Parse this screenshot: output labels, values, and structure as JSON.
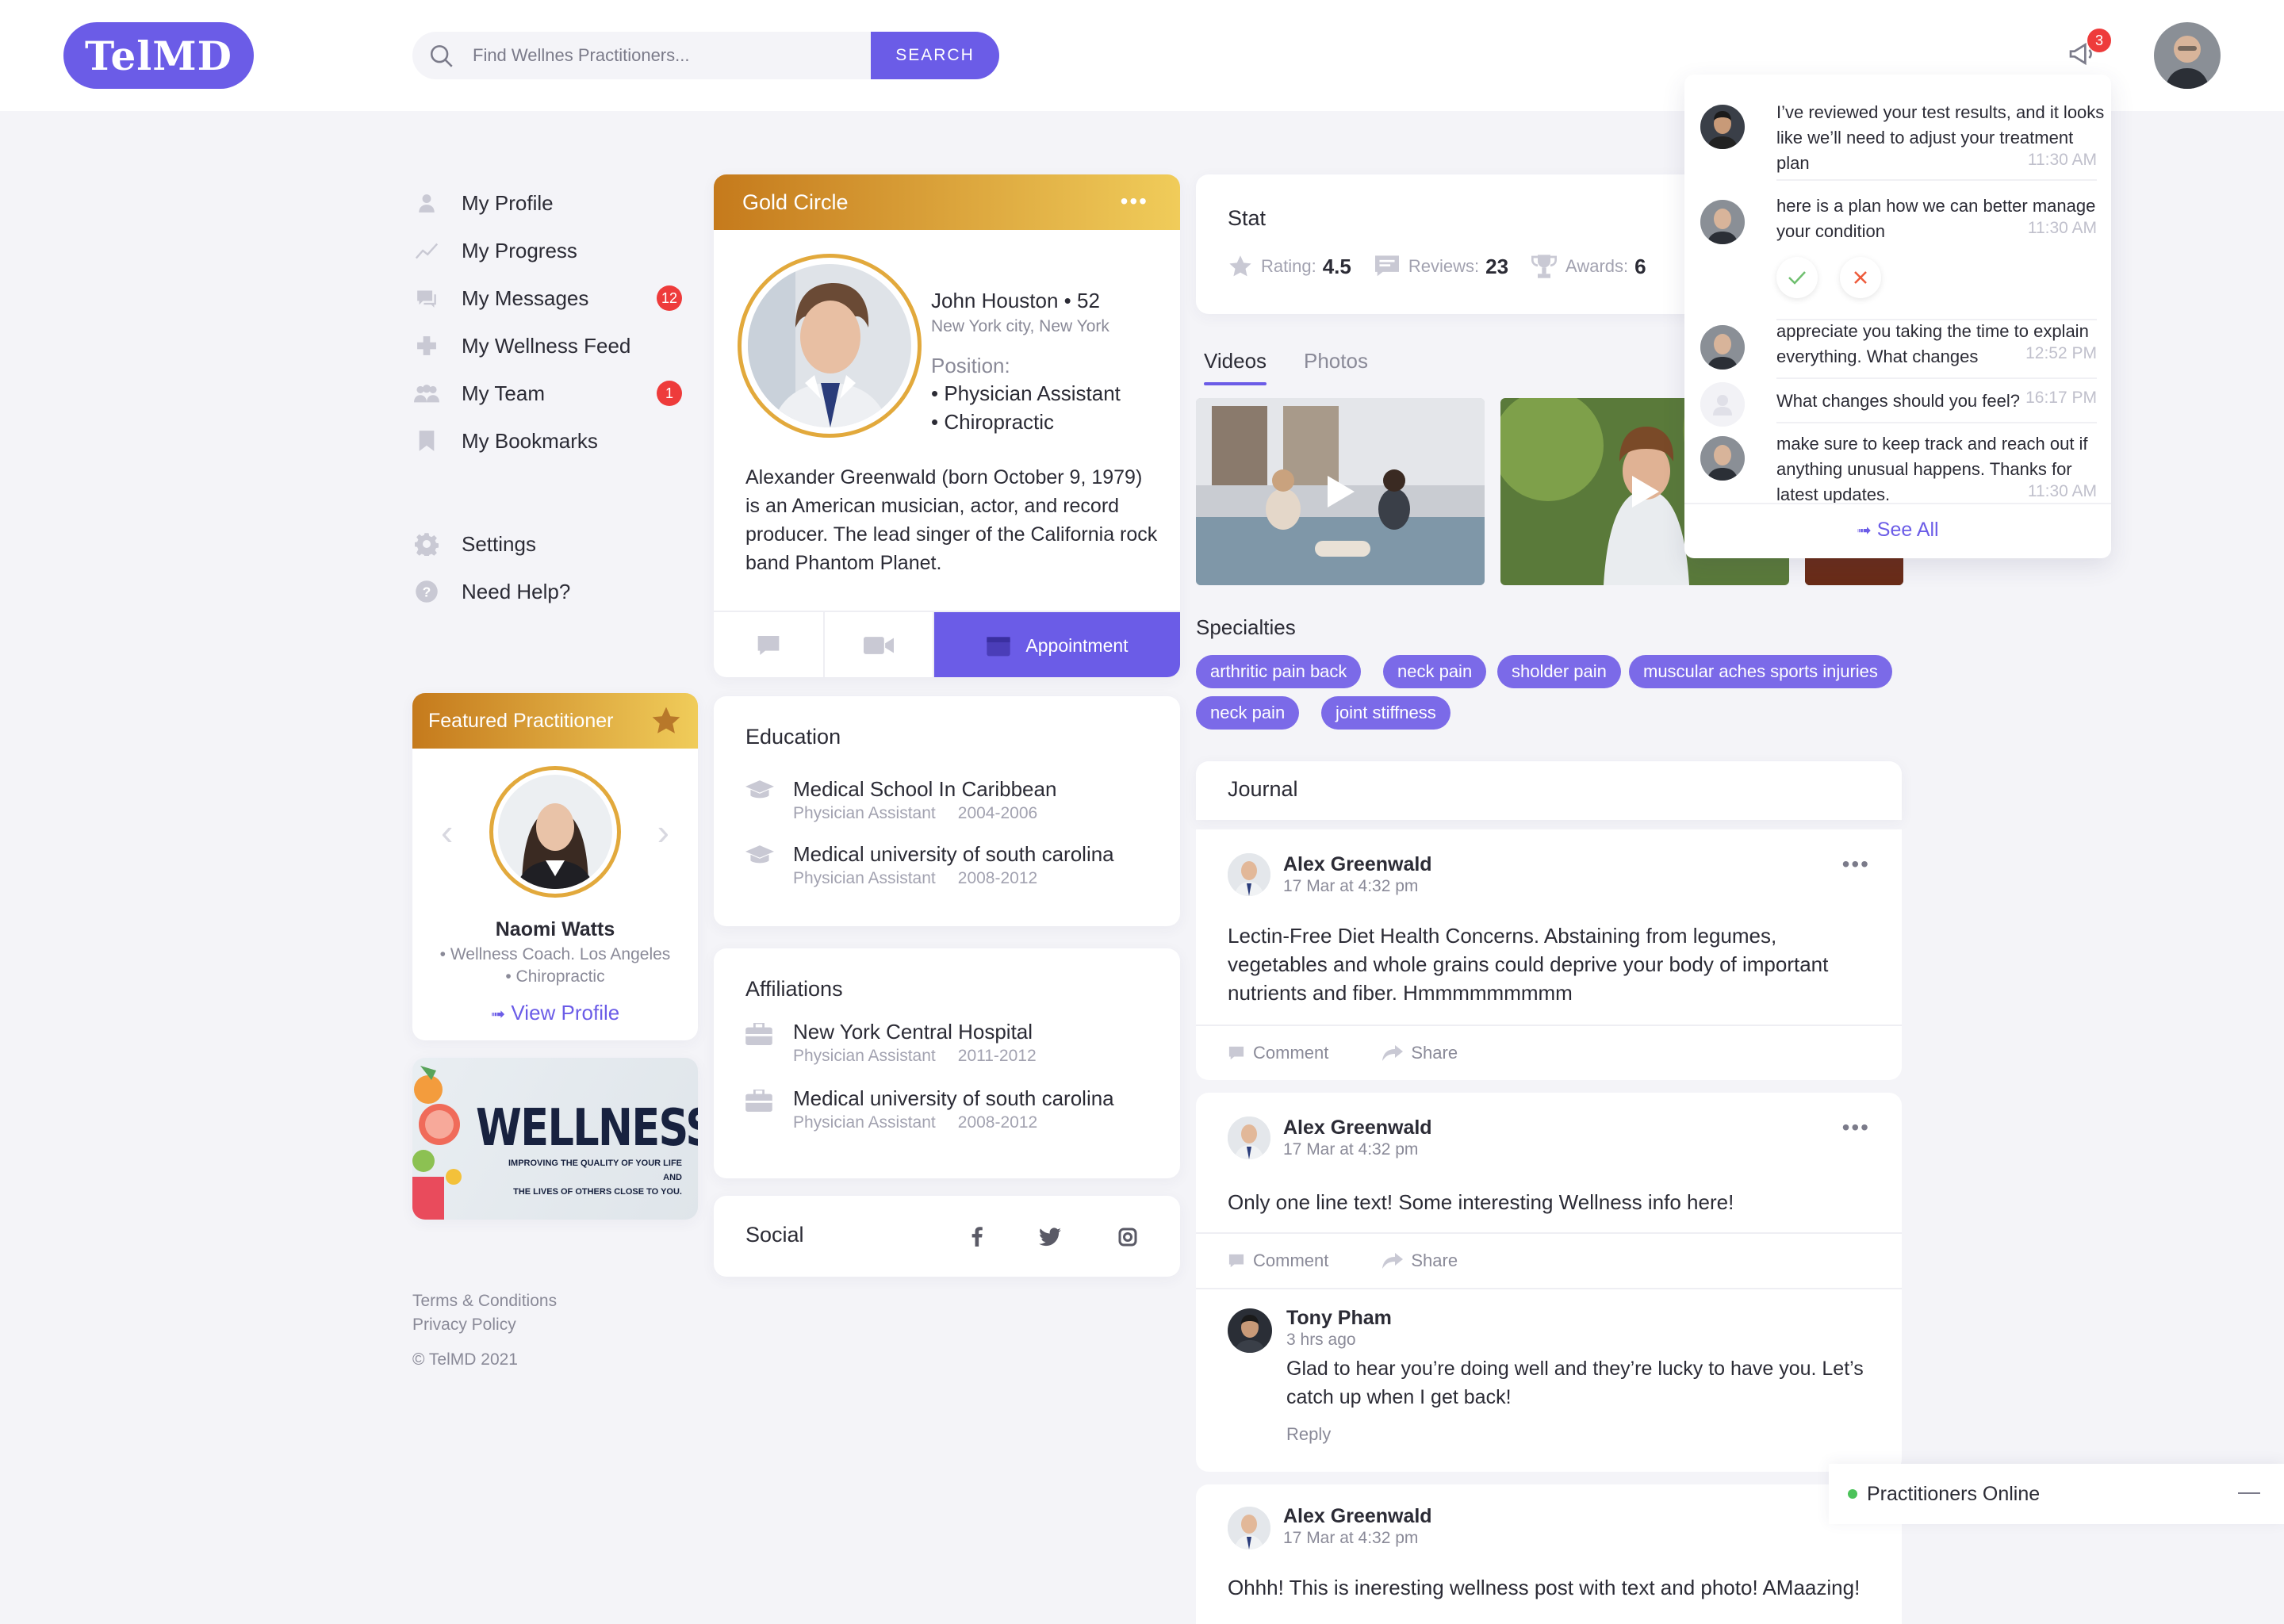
{
  "header": {
    "logo": "TelMD",
    "search_placeholder": "Find Wellnes Practitioners...",
    "search_button": "SEARCH",
    "notification_count": "3"
  },
  "nav": {
    "items": [
      {
        "label": "My Profile",
        "icon": "user-icon",
        "badge": ""
      },
      {
        "label": "My Progress",
        "icon": "progress-icon",
        "badge": ""
      },
      {
        "label": "My Messages",
        "icon": "messages-icon",
        "badge": "12"
      },
      {
        "label": "My Wellness Feed",
        "icon": "feed-icon",
        "badge": ""
      },
      {
        "label": "My Team",
        "icon": "team-icon",
        "badge": "1"
      },
      {
        "label": "My Bookmarks",
        "icon": "bookmark-icon",
        "badge": ""
      }
    ],
    "secondary": [
      {
        "label": "Settings",
        "icon": "gear-icon"
      },
      {
        "label": "Need Help?",
        "icon": "help-icon"
      }
    ]
  },
  "featured": {
    "title": "Featured Practitioner",
    "name": "Naomi Watts",
    "role1": "• Wellness Coach. Los Angeles",
    "role2": "• Chiropractic",
    "link": "View Profile"
  },
  "banner": {
    "title": "WELLNESS",
    "line1": "IMPROVING THE QUALITY OF YOUR LIFE AND",
    "line2": "THE LIVES OF OTHERS CLOSE TO YOU."
  },
  "footer": {
    "terms": "Terms & Conditions",
    "privacy": "Privacy Policy",
    "copyright": "© TelMD 2021"
  },
  "profile": {
    "tier": "Gold Circle",
    "name": "John Houston • 52",
    "location": "New York city, New York",
    "position_label": "Position:",
    "positions": [
      "• Physician Assistant",
      "• Chiropractic"
    ],
    "bio": "Alexander Greenwald (born October 9, 1979) is an American musician, actor, and record producer. The lead singer of the California rock band Phantom Planet.",
    "appointment": "Appointment"
  },
  "education": {
    "title": "Education",
    "items": [
      {
        "school": "Medical School In Caribbean",
        "role": "Physician Assistant",
        "years": "2004-2006"
      },
      {
        "school": "Medical university of south carolina",
        "role": "Physician Assistant",
        "years": "2008-2012"
      }
    ]
  },
  "affiliations": {
    "title": "Affiliations",
    "items": [
      {
        "school": "New York Central Hospital",
        "role": "Physician Assistant",
        "years": "2011-2012"
      },
      {
        "school": "Medical university of south carolina",
        "role": "Physician Assistant",
        "years": "2008-2012"
      }
    ]
  },
  "social": {
    "title": "Social"
  },
  "stat": {
    "title": "Stat",
    "rating_label": "Rating:",
    "rating": "4.5",
    "reviews_label": "Reviews:",
    "reviews": "23",
    "awards_label": "Awards:",
    "awards": "6"
  },
  "media_tabs": [
    "Videos",
    "Photos"
  ],
  "specialties": {
    "title": "Specialties",
    "chips": [
      "arthritic pain back",
      "neck pain",
      "sholder pain",
      "muscular aches sports injuries",
      "neck pain",
      "joint stiffness"
    ]
  },
  "journal": {
    "title": "Journal",
    "comment": "Comment",
    "share": "Share",
    "posts": [
      {
        "author": "Alex Greenwald",
        "time": "17 Mar at 4:32 pm",
        "text": "Lectin-Free Diet Health Concerns. Abstaining from legumes, vegetables and whole grains could deprive your body of important nutrients and fiber. Hmmmmmmmmm"
      },
      {
        "author": "Alex Greenwald",
        "time": "17 Mar at 4:32 pm",
        "text": "Only one line text! Some interesting Wellness info here!"
      },
      {
        "author": "Alex Greenwald",
        "time": "17 Mar at 4:32 pm",
        "text": "Ohhh! This is ineresting wellness post with text and photo! AMaazing!"
      }
    ],
    "comment_item": {
      "author": "Tony Pham",
      "time": "3 hrs ago",
      "text": "Glad to hear you’re doing well and they’re lucky to have you. Let’s catch up when I get back!",
      "reply": "Reply"
    }
  },
  "notifications": {
    "items": [
      {
        "text": "I’ve reviewed your test results, and it looks like we’ll need to adjust your treatment plan",
        "time": "11:30 AM"
      },
      {
        "text": "here is a plan how we can better manage your condition",
        "time": "11:30 AM"
      },
      {
        "text": "appreciate you taking the time to explain everything. What changes",
        "time": "12:52 PM"
      },
      {
        "text": "What changes should you feel?",
        "time": "16:17 PM"
      },
      {
        "text": "make sure to keep track and reach out if anything unusual happens. Thanks for latest updates.",
        "time": "11:30 AM"
      }
    ],
    "see_all": "See All"
  },
  "online": {
    "label": "Practitioners Online"
  },
  "colors": {
    "accent": "#6b5ce7",
    "gold_start": "#c57a1c",
    "gold_end": "#f0cc5a",
    "badge": "#ee3b3b",
    "online": "#4cc35a"
  }
}
